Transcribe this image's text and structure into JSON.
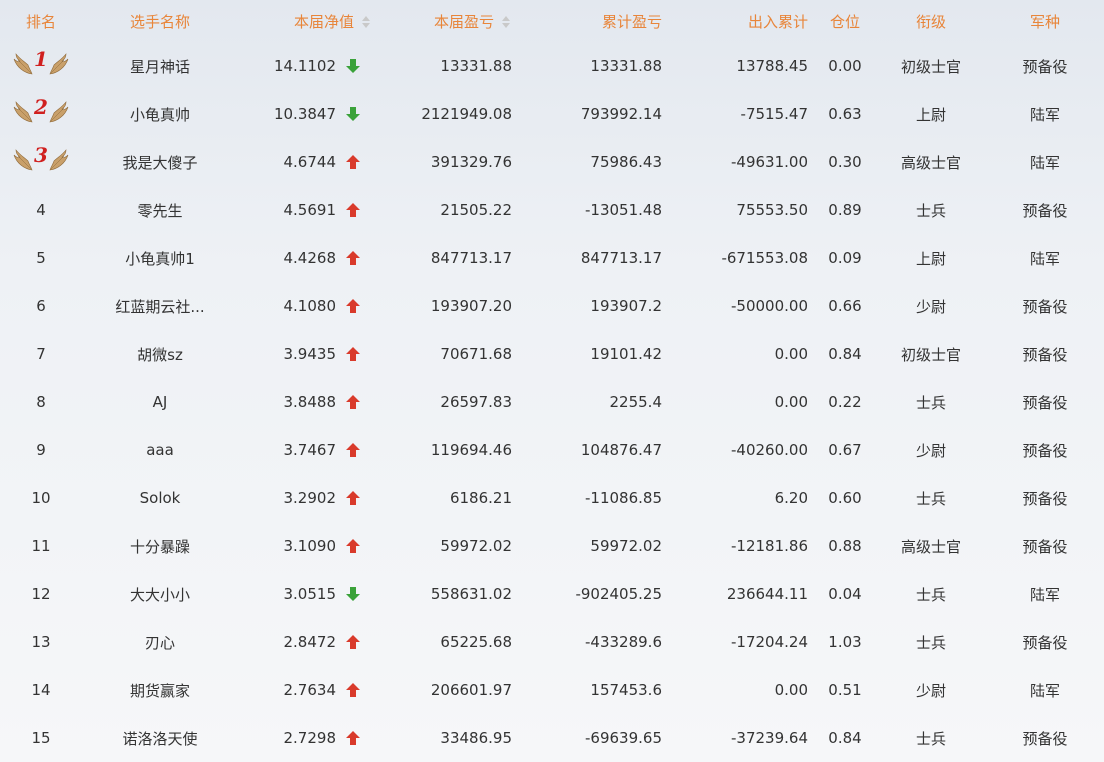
{
  "columns": {
    "rank": "排名",
    "name": "选手名称",
    "nav": "本届净值",
    "profit": "本届盈亏",
    "cum_profit": "累计盈亏",
    "flow": "出入累计",
    "position": "仓位",
    "title": "衔级",
    "branch": "军种"
  },
  "colors": {
    "header": "#e8853a",
    "up": "#d93a2b",
    "down": "#3aa23a",
    "rank_top": "#d0201f",
    "wing": "#c9a06a"
  },
  "rows": [
    {
      "rank": "1",
      "name": "星月神话",
      "nav": "14.1102",
      "trend": "down",
      "profit": "13331.88",
      "cum_profit": "13331.88",
      "flow": "13788.45",
      "position": "0.00",
      "title": "初级士官",
      "branch": "预备役"
    },
    {
      "rank": "2",
      "name": "小龟真帅",
      "nav": "10.3847",
      "trend": "down",
      "profit": "2121949.08",
      "cum_profit": "793992.14",
      "flow": "-7515.47",
      "position": "0.63",
      "title": "上尉",
      "branch": "陆军"
    },
    {
      "rank": "3",
      "name": "我是大傻子",
      "nav": "4.6744",
      "trend": "up",
      "profit": "391329.76",
      "cum_profit": "75986.43",
      "flow": "-49631.00",
      "position": "0.30",
      "title": "高级士官",
      "branch": "陆军"
    },
    {
      "rank": "4",
      "name": "零先生",
      "nav": "4.5691",
      "trend": "up",
      "profit": "21505.22",
      "cum_profit": "-13051.48",
      "flow": "75553.50",
      "position": "0.89",
      "title": "士兵",
      "branch": "预备役"
    },
    {
      "rank": "5",
      "name": "小龟真帅1",
      "nav": "4.4268",
      "trend": "up",
      "profit": "847713.17",
      "cum_profit": "847713.17",
      "flow": "-671553.08",
      "position": "0.09",
      "title": "上尉",
      "branch": "陆军"
    },
    {
      "rank": "6",
      "name": "红蓝期云社...",
      "nav": "4.1080",
      "trend": "up",
      "profit": "193907.20",
      "cum_profit": "193907.2",
      "flow": "-50000.00",
      "position": "0.66",
      "title": "少尉",
      "branch": "预备役"
    },
    {
      "rank": "7",
      "name": "胡微sz",
      "nav": "3.9435",
      "trend": "up",
      "profit": "70671.68",
      "cum_profit": "19101.42",
      "flow": "0.00",
      "position": "0.84",
      "title": "初级士官",
      "branch": "预备役"
    },
    {
      "rank": "8",
      "name": "AJ",
      "nav": "3.8488",
      "trend": "up",
      "profit": "26597.83",
      "cum_profit": "2255.4",
      "flow": "0.00",
      "position": "0.22",
      "title": "士兵",
      "branch": "预备役"
    },
    {
      "rank": "9",
      "name": "aaa",
      "nav": "3.7467",
      "trend": "up",
      "profit": "119694.46",
      "cum_profit": "104876.47",
      "flow": "-40260.00",
      "position": "0.67",
      "title": "少尉",
      "branch": "预备役"
    },
    {
      "rank": "10",
      "name": "Solok",
      "nav": "3.2902",
      "trend": "up",
      "profit": "6186.21",
      "cum_profit": "-11086.85",
      "flow": "6.20",
      "position": "0.60",
      "title": "士兵",
      "branch": "预备役"
    },
    {
      "rank": "11",
      "name": "十分暴躁",
      "nav": "3.1090",
      "trend": "up",
      "profit": "59972.02",
      "cum_profit": "59972.02",
      "flow": "-12181.86",
      "position": "0.88",
      "title": "高级士官",
      "branch": "预备役"
    },
    {
      "rank": "12",
      "name": "大大小小",
      "nav": "3.0515",
      "trend": "down",
      "profit": "558631.02",
      "cum_profit": "-902405.25",
      "flow": "236644.11",
      "position": "0.04",
      "title": "士兵",
      "branch": "陆军"
    },
    {
      "rank": "13",
      "name": "刃心",
      "nav": "2.8472",
      "trend": "up",
      "profit": "65225.68",
      "cum_profit": "-433289.6",
      "flow": "-17204.24",
      "position": "1.03",
      "title": "士兵",
      "branch": "预备役"
    },
    {
      "rank": "14",
      "name": "期货赢家",
      "nav": "2.7634",
      "trend": "up",
      "profit": "206601.97",
      "cum_profit": "157453.6",
      "flow": "0.00",
      "position": "0.51",
      "title": "少尉",
      "branch": "陆军"
    },
    {
      "rank": "15",
      "name": "诺洛洛天使",
      "nav": "2.7298",
      "trend": "up",
      "profit": "33486.95",
      "cum_profit": "-69639.65",
      "flow": "-37239.64",
      "position": "0.84",
      "title": "士兵",
      "branch": "预备役"
    }
  ]
}
